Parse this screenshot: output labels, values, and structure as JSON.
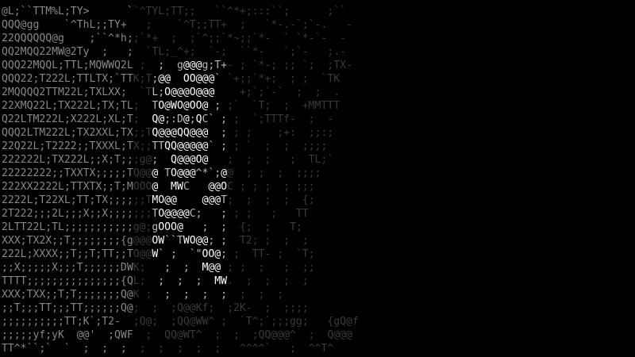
{
  "palette": {
    "background": "#000000",
    "shades": [
      "#1c1c1c",
      "#3a3a3a",
      "#5e5e5e",
      "#888888",
      "#b8b8b8",
      "#ffffff"
    ]
  },
  "figure_description": "ASCII-art render of a figure in the center surrounded by textured character noise",
  "rows": [
    {
      "text": "@L;``TTM%L;TY>      ``^TYL;TT;;   ``^*+;:::``;      ;``",
      "shade": 2
    },
    {
      "text": "QQQ@gg    `^ThL;;TY+   ;    `^T;;TT+  ;   `*-.-`;`-.   -",
      "shade": 2
    },
    {
      "text": "22QQQQQQ@g    ;``^*h;;`*+  ;  ;`^;;`*~;;`*-  ` `*-`-  -",
      "shade": 2
    },
    {
      "text": "QQ2MQQ22MW@2Ty  ;   ;  `TL;_^+;  `-;  ``*-   `;`-   ;.-",
      "shade": 2
    },
    {
      "text": "QQQ22MQQL;TTL;MQWWQ2L ;  ;  g@@@g;T+- ; `*-; ;; `;  ;TX-",
      "shade": 2
    },
    {
      "text": "QQQ22;T222L;TTLTX;`TTK;T;@@  OO@@@` `+;;`*+;  ; ;  `TK",
      "shade": 2
    },
    {
      "text": "2MQQQQ2TTM22L;TXLXX;  `TL;O@@@O@@@    +;`;`-`  ;  ;  .",
      "shade": 2
    },
    {
      "text": "22XMQ22L;TX222L;TX;TL;  TO@WO@OO@ ; ;`  `T;  ;  +MMTTT",
      "shade": 2
    },
    {
      "text": "Q22LTM222L;X222L;XL;T;  Q@;:D@;QC` ; ;  `;TTTf-  ;  -",
      "shade": 2
    },
    {
      "text": "QQQ2LTM222L;TX2XXL;TX;;TQ@@@QQ@@@  ; ; ;    ;+:  ;;:;",
      "shade": 2
    },
    {
      "text": "22Q22L;T2222;;TXXXL;TX;;TTQQ@@@@@` ; ; `  ;  ;  ;;;;",
      "shade": 2
    },
    {
      "text": "222222L;TX222L;;X;T;;;g@;  Q@@@O@   ;  ;  ;   ;  TL;`",
      "shade": 2
    },
    {
      "text": "22222222;;TXXTX;;;;;TQ@@@ TO@@@^*`;@@  ; ;  ;  ;;;;",
      "shade": 2
    },
    {
      "text": "222XX2222L;TTXTX;;T;MOOO@  MWC   @@OC ; ; ;  ; ;;;",
      "shade": 2
    },
    {
      "text": "2222L;T22XL;TT;TX;;;;;;TMO@@    @@@T;  ;  ;  ;  {;",
      "shade": 2
    },
    {
      "text": "2T222;;;2L;;;X;;X;;;;;;;TO@@@@C;   ; ; ;   ;   TT",
      "shade": 2
    },
    {
      "text": "2LTT22L;TL;;;;;;;;;;;g@;gOOO@   ;  ;  {;  ;   T;",
      "shade": 2
    },
    {
      "text": "XXX;TX2X;;T;;;;;;;;{g@@@OW``TWO@@; ;  T2; ;  ;  ;",
      "shade": 2
    },
    {
      "text": "222L;XXXX;;T;;T;TT;;TO@@W` ;  `\"OO@; ;  TT- ;  `T;",
      "shade": 2
    },
    {
      "text": ";;X;;;;;X;;;T;;;;;;DWK;   ;  ;  M@@ ; ;  ;   ;  ;;",
      "shade": 2
    },
    {
      "text": "TTTT;;;;;;;;;;;;;;;{QL;  ;  ;  ;  MW.  ;  ;  ;  ;",
      "shade": 2
    },
    {
      "text": "XXX;TXX;;T;T;;;;;;;Q@K ;  ;  ;  ;  ;  ;  ;  ;",
      "shade": 2
    },
    {
      "text": ";;T;;;TT;;;TT;;;;;;Q@;  ;  ;Q@@Kf;  ;2K-  ;  ;;;;",
      "shade": 2
    },
    {
      "text": ";;;;;;;;;;TT;K`;T2-  ;Q@;  ;QQ@WW^ ;  `T^;`;;;gg;   {gQ@f",
      "shade": 2
    },
    {
      "text": ";;;;;yf;yK  @@'  ;QWF  ;  QQ@WT^  ;  ;  ;QQ@@@^  ;  Q@@@",
      "shade": 2
    },
    {
      "text": "TT^*``;`  `  ;  ;  ;  ;  ;  ;  ;  ;   ^^^^`   ;  ^^T^",
      "shade": 2
    }
  ]
}
